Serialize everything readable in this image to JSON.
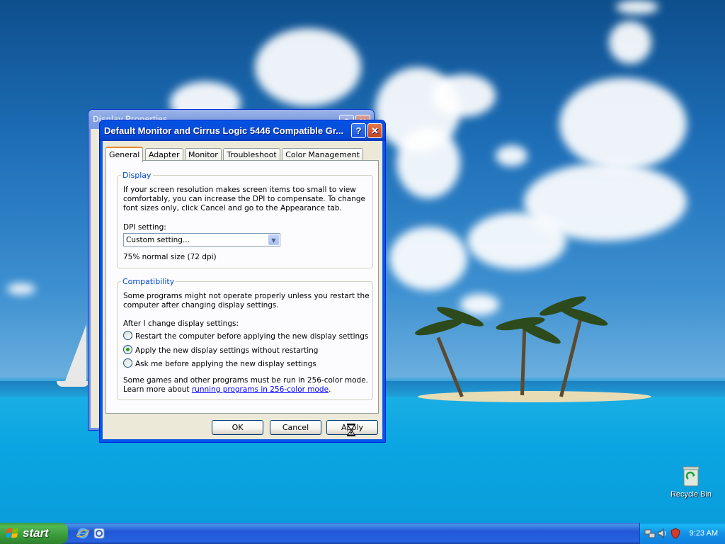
{
  "desktop": {
    "icons": [
      {
        "label": "Recycle Bin",
        "icon": "recycle-bin-icon"
      }
    ]
  },
  "back_window": {
    "title": "Display Properties"
  },
  "dialog": {
    "title": "Default Monitor and Cirrus Logic 5446 Compatible Gr...",
    "tabs": [
      "General",
      "Adapter",
      "Monitor",
      "Troubleshoot",
      "Color Management"
    ],
    "active_tab": "General",
    "display_group": {
      "legend": "Display",
      "description_lines": [
        "If your screen resolution makes screen items too small to view",
        "comfortably, you can increase the DPI to compensate.  To change",
        "font sizes only, click Cancel and go to the Appearance tab."
      ],
      "dpi_label": "DPI setting:",
      "dpi_value": "Custom setting...",
      "dpi_size_text": "75% normal size (72 dpi)"
    },
    "compatibility_group": {
      "legend": "Compatibility",
      "description_lines": [
        "Some programs might not operate properly unless you restart the",
        "computer after changing display settings."
      ],
      "after_change_label": "After I change display settings:",
      "options": [
        {
          "label": "Restart the computer before applying the new display settings",
          "selected": false
        },
        {
          "label": "Apply the new display settings without restarting",
          "selected": true
        },
        {
          "label": "Ask me before applying the new display settings",
          "selected": false
        }
      ],
      "games_line": "Some games and other programs must be run in 256-color mode.",
      "learn_prefix": "Learn more about ",
      "learn_link": "running programs in 256-color mode",
      "learn_suffix": "."
    },
    "buttons": {
      "ok": "OK",
      "cancel": "Cancel",
      "apply": "Apply"
    }
  },
  "taskbar": {
    "start_label": "start",
    "quick_launch": [
      "internet-explorer-icon",
      "outlook-express-icon"
    ],
    "tray_icons": [
      "network-icon",
      "sound-icon",
      "security-icon"
    ],
    "clock": "9:23 AM"
  },
  "colors": {
    "titlebar_active": "#0a4fdc",
    "start_button": "#3a9a3a",
    "taskbar": "#2157d7",
    "tab_highlight": "#e68b2c",
    "group_legend": "#0046d5"
  }
}
